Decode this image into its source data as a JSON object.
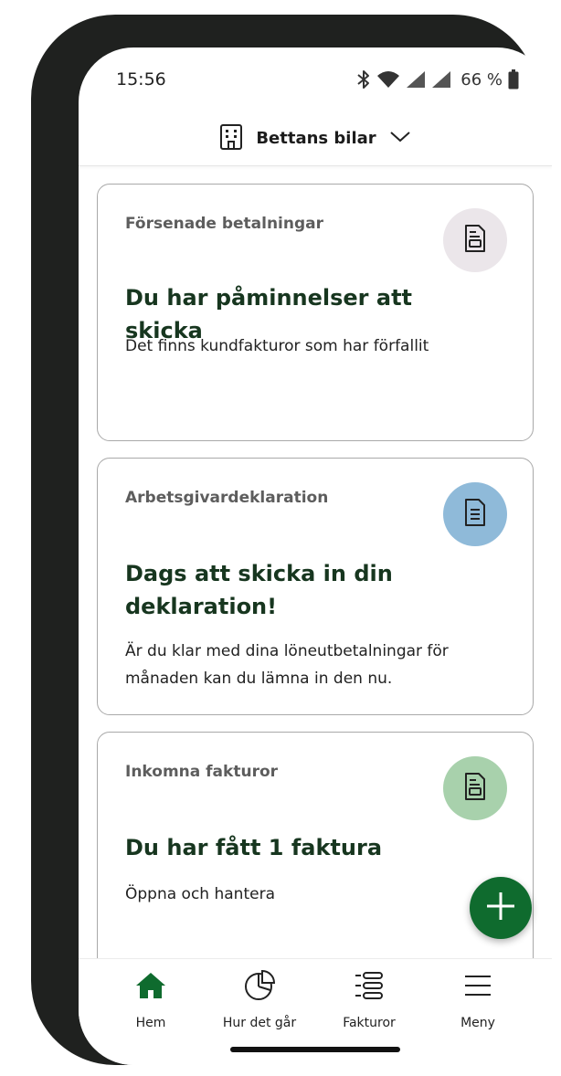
{
  "status_bar": {
    "time": "15:56",
    "battery": "66 %"
  },
  "header": {
    "company": "Bettans bilar"
  },
  "cards": [
    {
      "category": "Försenade betalningar",
      "title": "Du har påminnelser att skicka",
      "description": "Det finns kundfakturor som har förfallit",
      "icon": "invoice-reminder-icon",
      "icon_bg": "#ebe6ea"
    },
    {
      "category": "Arbetsgivardeklaration",
      "title": "Dags att skicka in din deklaration!",
      "description": "Är du klar med dina löneutbetalningar för månaden kan du lämna in den nu.",
      "icon": "document-icon",
      "icon_bg": "#8fbad9"
    },
    {
      "category": "Inkomna fakturor",
      "title": "Du har fått 1 faktura",
      "description": "Öppna och hantera",
      "icon": "invoice-icon",
      "icon_bg": "#a8d1ac"
    }
  ],
  "nav": [
    {
      "label": "Hem",
      "icon": "home-icon",
      "active": true
    },
    {
      "label": "Hur det går",
      "icon": "pie-chart-icon",
      "active": false
    },
    {
      "label": "Fakturor",
      "icon": "list-icon",
      "active": false
    },
    {
      "label": "Meny",
      "icon": "menu-icon",
      "active": false
    }
  ],
  "colors": {
    "accent": "#0f6b2e",
    "title": "#17361f"
  }
}
